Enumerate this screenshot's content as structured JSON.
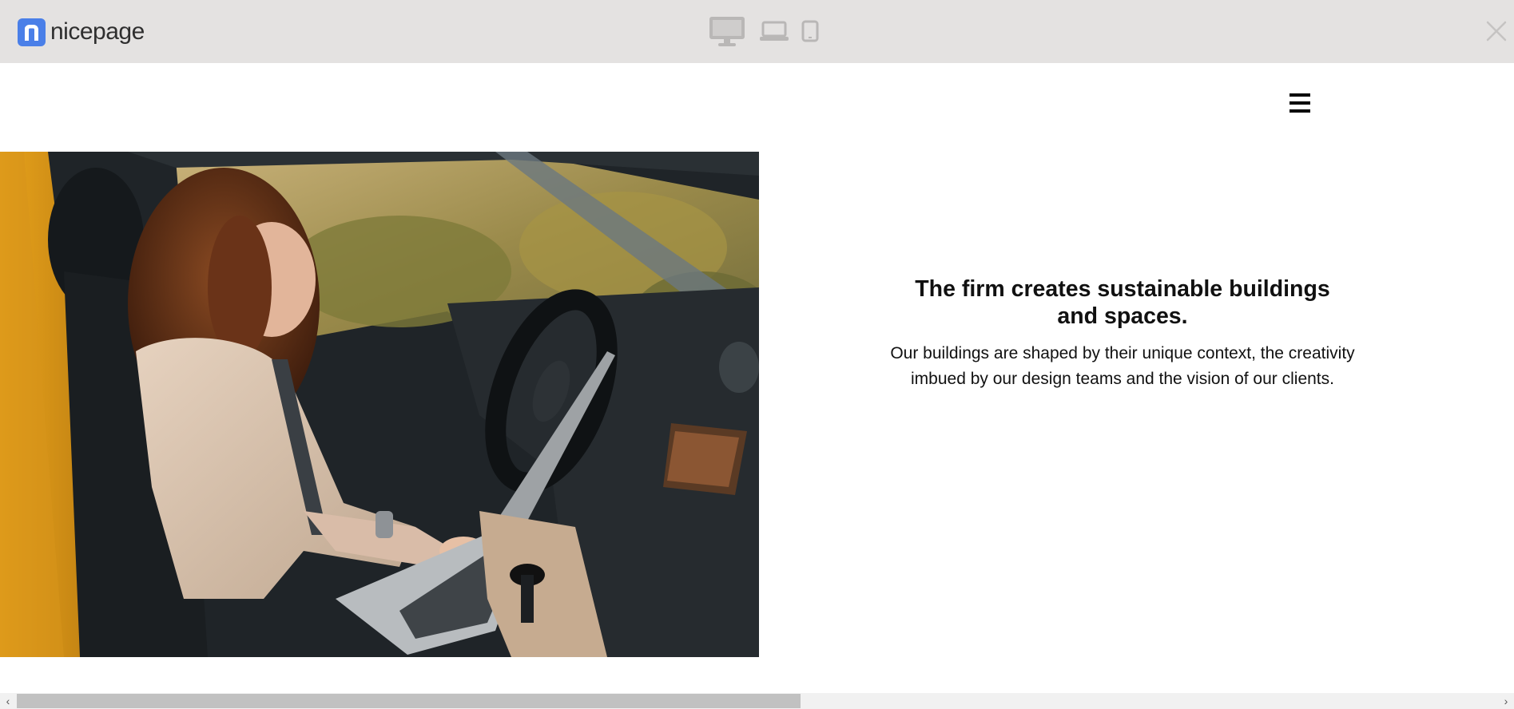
{
  "toolbar": {
    "brand": "nicepage",
    "logo_letter": "n",
    "devices": [
      "desktop-icon",
      "laptop-icon",
      "tablet-icon"
    ],
    "close_icon": "close-icon",
    "accent": "#4a7fe8",
    "background": "#e4e2e1"
  },
  "header": {
    "menu_icon": "hamburger-menu-icon"
  },
  "hero": {
    "title": "The firm creates sustainable buildings and spaces.",
    "body": "Our buildings are shaped by their unique context, the creativity imbued by our design teams and the vision of our clients.",
    "image": "woman-working-on-laptop-in-car-photo"
  },
  "scrollbar": {
    "left_arrow": "‹",
    "right_arrow": "›"
  }
}
